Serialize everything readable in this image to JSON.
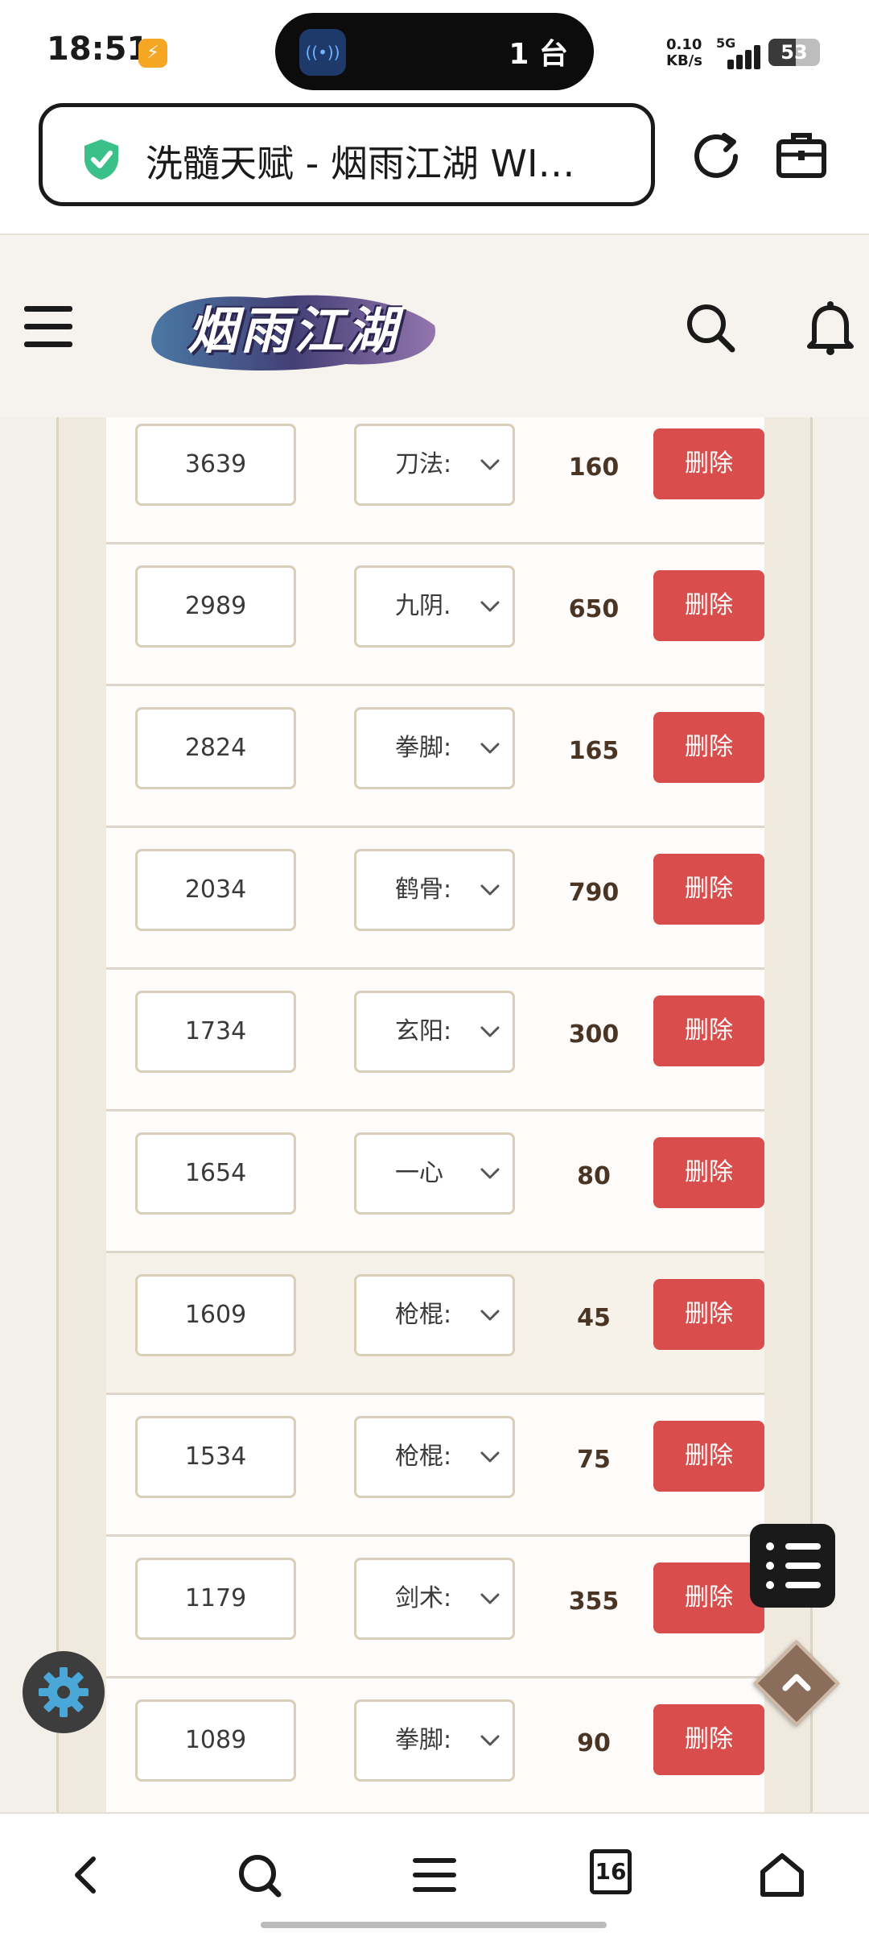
{
  "status_bar": {
    "time": "18:51",
    "app_badge": "⚡",
    "island_icon_label": "((•))",
    "island_text": "1 台",
    "net_speed_value": "0.10",
    "net_speed_unit": "KB/s",
    "network": "5G",
    "battery": "53",
    "battery_level": 0.53
  },
  "browser": {
    "page_title": "洗髓天赋 - 烟雨江湖 WI…",
    "icons": [
      "shield-check-icon",
      "reload-icon",
      "toolbox-icon"
    ]
  },
  "site_header": {
    "logo_text": "烟雨江湖",
    "icons": [
      "menu-icon",
      "search-icon",
      "bell-icon"
    ]
  },
  "rows": [
    {
      "id": "3639",
      "skill": "刀法:",
      "value": "160",
      "action": "删除"
    },
    {
      "id": "2989",
      "skill": "九阴.",
      "value": "650",
      "action": "删除"
    },
    {
      "id": "2824",
      "skill": "拳脚:",
      "value": "165",
      "action": "删除"
    },
    {
      "id": "2034",
      "skill": "鹤骨:",
      "value": "790",
      "action": "删除"
    },
    {
      "id": "1734",
      "skill": "玄阳:",
      "value": "300",
      "action": "删除"
    },
    {
      "id": "1654",
      "skill": "一心",
      "value": "80",
      "action": "删除"
    },
    {
      "id": "1609",
      "skill": "枪棍:",
      "value": "45",
      "action": "删除"
    },
    {
      "id": "1534",
      "skill": "枪棍:",
      "value": "75",
      "action": "删除"
    },
    {
      "id": "1179",
      "skill": "剑术:",
      "value": "355",
      "action": "删除"
    },
    {
      "id": "1089",
      "skill": "拳脚:",
      "value": "90",
      "action": "删除"
    }
  ],
  "bottom_nav": {
    "tab_count": "16",
    "icons": [
      "back-icon",
      "search-icon",
      "menu-icon",
      "tabs-icon",
      "home-icon"
    ]
  },
  "colors": {
    "delete_button": "#d94d4d",
    "shield": "#3cc08a",
    "value_text": "#4a3525"
  }
}
